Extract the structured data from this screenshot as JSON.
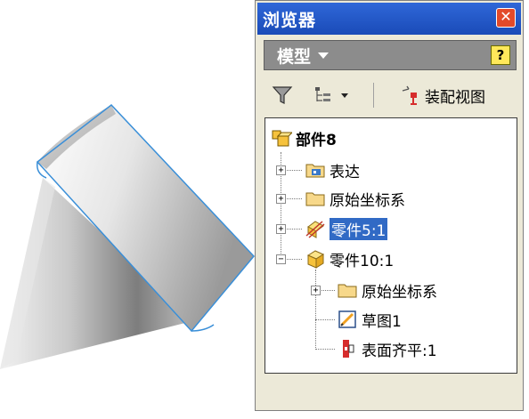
{
  "viewport": {
    "model": "cone-with-cylinder"
  },
  "browser": {
    "title": "浏览器",
    "panel_selector": "模型",
    "toolbar": {
      "view_label": "装配视图"
    },
    "tree": {
      "root": "部件8",
      "items": [
        {
          "label": "表达",
          "icon": "representation-icon"
        },
        {
          "label": "原始坐标系",
          "icon": "folder-icon"
        },
        {
          "label": "零件5:1",
          "icon": "part-adaptive-icon",
          "selected": true
        },
        {
          "label": "零件10:1",
          "icon": "part-icon",
          "expanded": true,
          "children": [
            {
              "label": "原始坐标系",
              "icon": "folder-icon"
            },
            {
              "label": "草图1",
              "icon": "sketch-icon"
            },
            {
              "label": "表面齐平:1",
              "icon": "flush-constraint-icon"
            }
          ]
        }
      ]
    }
  },
  "colors": {
    "title_bar": "#1a4bb8",
    "selection": "#316ac5",
    "panel_bg": "#ece9d8"
  }
}
